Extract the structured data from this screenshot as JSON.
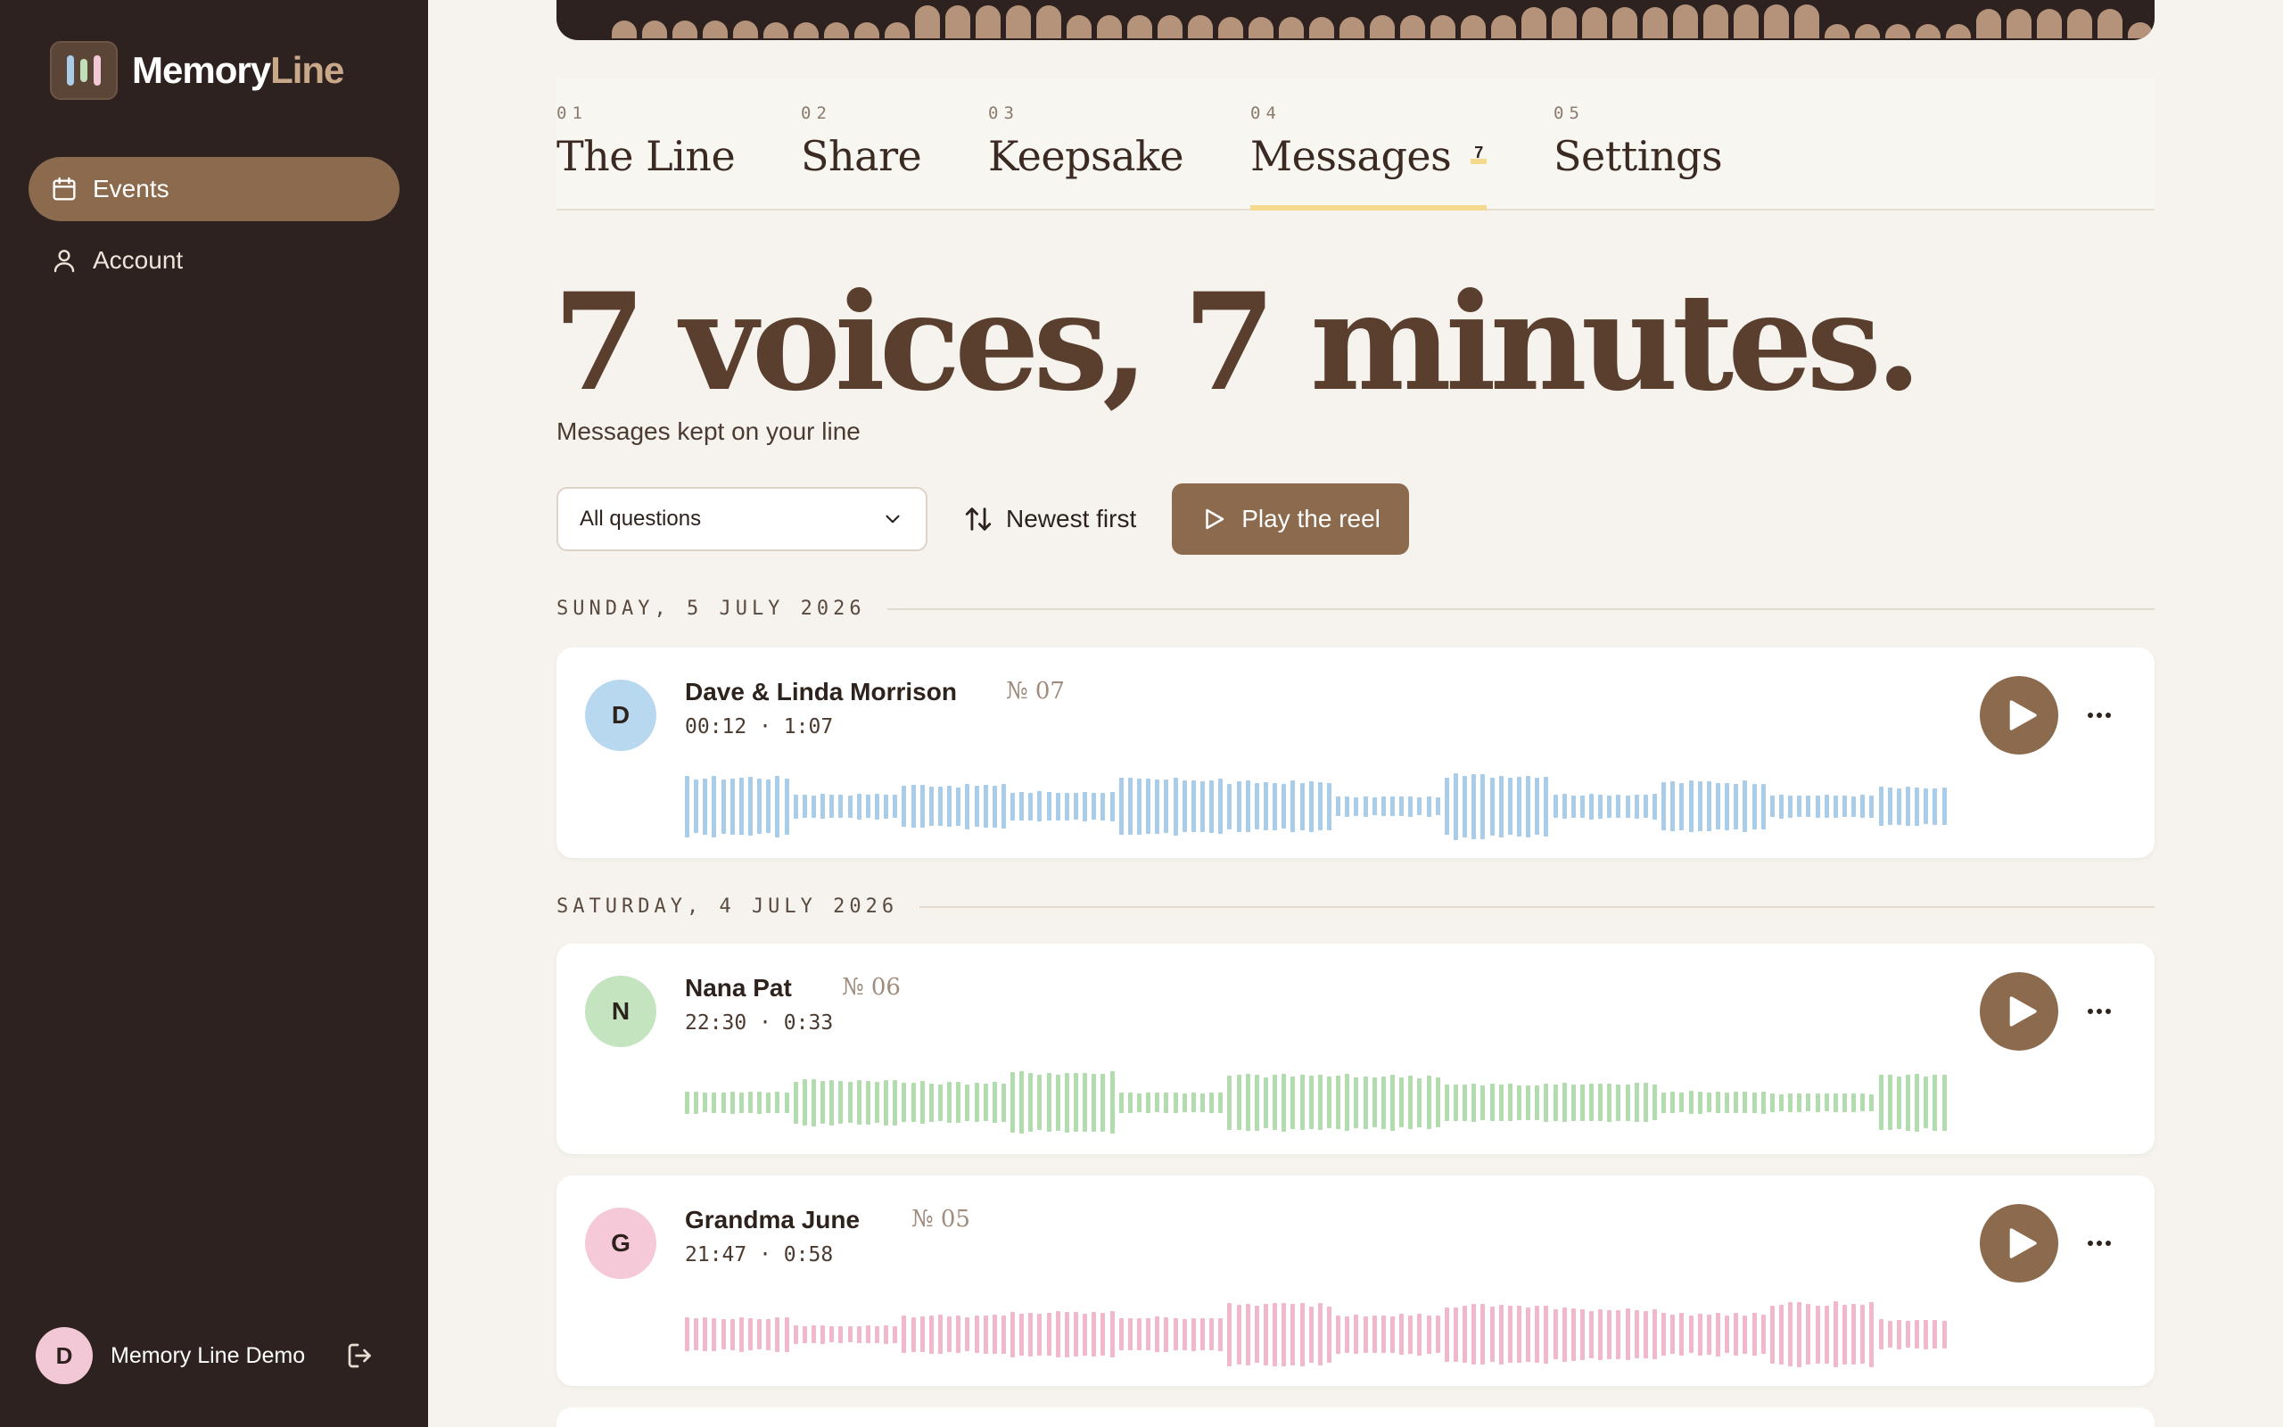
{
  "app": {
    "brand_part1": "Memory",
    "brand_part2": "Line",
    "logo_bar_colors": [
      "#a9cde8",
      "#bfe0b8",
      "#f2c7d6"
    ]
  },
  "sidebar": {
    "items": [
      {
        "label": "Events",
        "icon": "calendar-icon",
        "active": true
      },
      {
        "label": "Account",
        "icon": "user-icon",
        "active": false
      }
    ],
    "user": {
      "initial": "D",
      "name": "Memory Line Demo",
      "avatar_color": "#f2c7d6"
    }
  },
  "tabs": [
    {
      "num": "01",
      "label": "The Line"
    },
    {
      "num": "02",
      "label": "Share"
    },
    {
      "num": "03",
      "label": "Keepsake"
    },
    {
      "num": "04",
      "label": "Messages",
      "badge": "7",
      "active": true
    },
    {
      "num": "05",
      "label": "Settings"
    }
  ],
  "header": {
    "headline": "7 voices, 7 minutes.",
    "subhead": "Messages kept on your line"
  },
  "controls": {
    "filter_value": "All questions",
    "sort_label": "Newest first",
    "play_reel_label": "Play the reel"
  },
  "dates": [
    "SUNDAY, 5 JULY 2026",
    "SATURDAY, 4 JULY 2026"
  ],
  "messages": [
    {
      "initial": "D",
      "name": "Dave & Linda Morrison",
      "number": "№ 07",
      "time": "00:12",
      "duration": "1:07",
      "color": "#a9cde8",
      "avatar_color": "#b7d8ef"
    },
    {
      "initial": "N",
      "name": "Nana Pat",
      "number": "№ 06",
      "time": "22:30",
      "duration": "0:33",
      "color": "#b2dbae",
      "avatar_color": "#c4e4c0"
    },
    {
      "initial": "G",
      "name": "Grandma June",
      "number": "№ 05",
      "time": "21:47",
      "duration": "0:58",
      "color": "#f1b8cc",
      "avatar_color": "#f5c9d8"
    }
  ],
  "colors": {
    "sidebar_bg": "#2d221f",
    "accent": "#8c6a4e",
    "tab_underline": "#f5d98d",
    "page_bg": "#f6f3ee"
  }
}
